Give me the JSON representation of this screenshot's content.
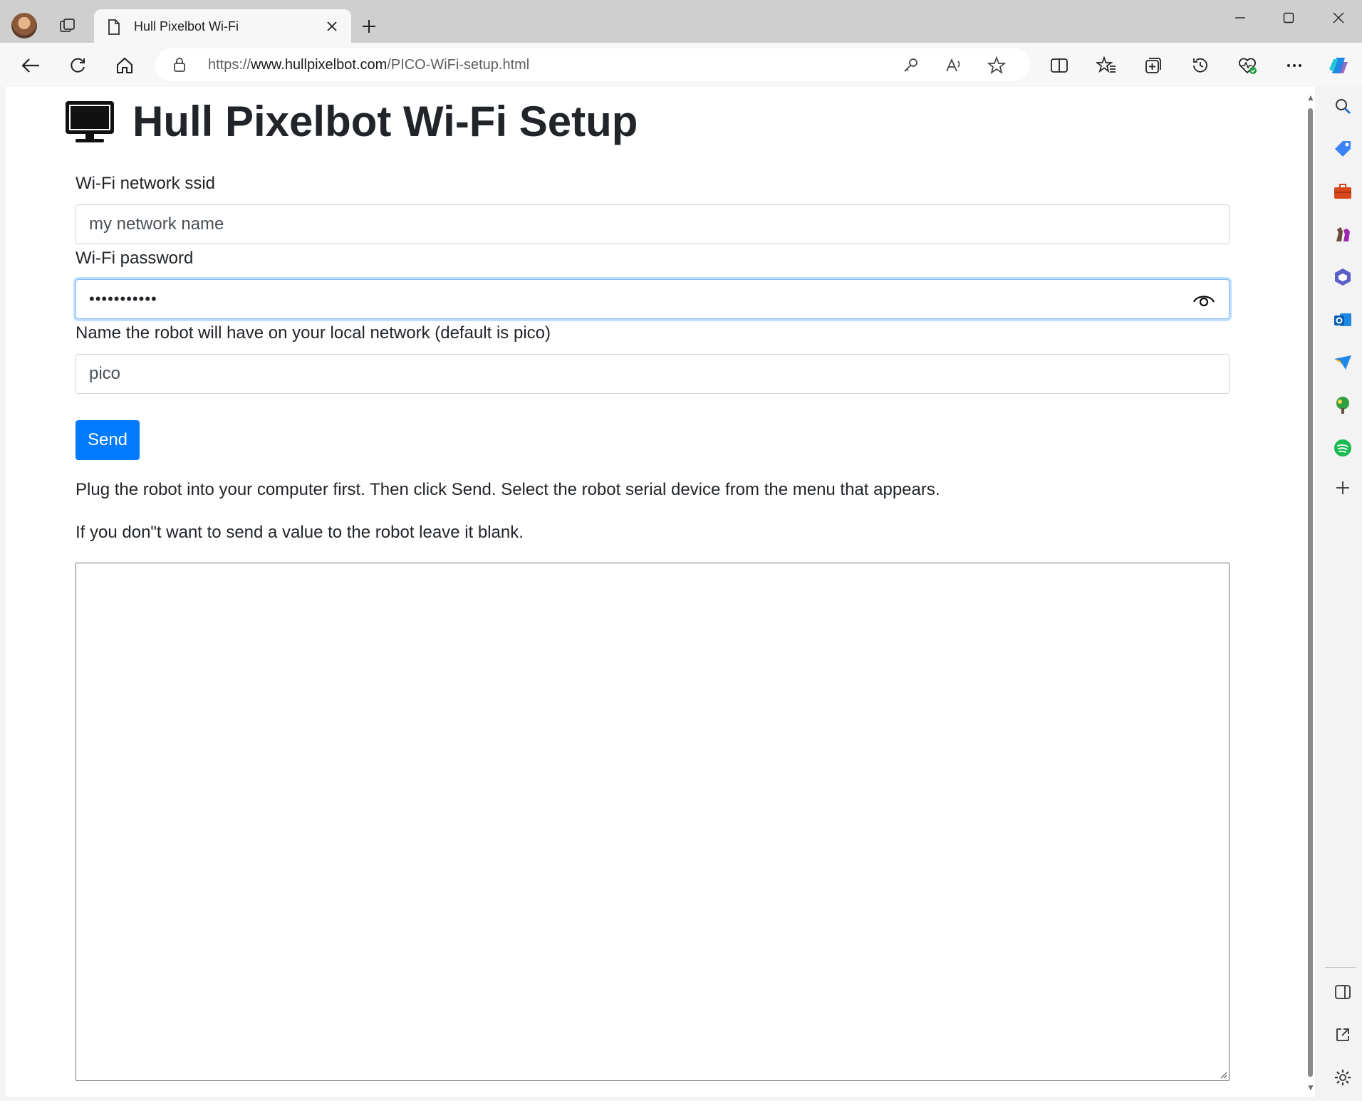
{
  "browser": {
    "tab_title": "Hull Pixelbot Wi-Fi",
    "url_prefix": "https://",
    "url_host": "www.hullpixelbot.com",
    "url_path": "/PICO-WiFi-setup.html"
  },
  "page": {
    "title": "Hull Pixelbot Wi-Fi Setup",
    "ssid_label": "Wi-Fi network ssid",
    "ssid_value": "my network name",
    "password_label": "Wi-Fi password",
    "password_masked": "•••••••••••",
    "hostname_label": "Name the robot will have on your local network (default is pico)",
    "hostname_value": "pico",
    "send_label": "Send",
    "instructions": "Plug the robot into your computer first. Then click Send. Select the robot serial device from the menu that appears.",
    "blank_note": "If you don\"t want to send a value to the robot leave it blank.",
    "output_text": ""
  },
  "colors": {
    "primary": "#007bff",
    "focus_border": "#80bdff",
    "text": "#212529"
  },
  "icons": {
    "toolbar": [
      "back-icon",
      "refresh-icon",
      "home-icon",
      "lock-icon",
      "key-icon",
      "read-aloud-icon",
      "favorite-star-icon",
      "split-screen-icon",
      "favorites-icon",
      "collections-icon",
      "history-icon",
      "browser-essentials-icon",
      "more-icon",
      "copilot-icon"
    ],
    "sidebar": [
      "search-icon",
      "shopping-icon",
      "tools-icon",
      "games-icon",
      "microsoft-365-icon",
      "outlook-icon",
      "drop-icon",
      "tree-icon",
      "spotify-icon",
      "add-icon",
      "sidebar-toggle-icon",
      "external-link-icon",
      "settings-icon"
    ]
  }
}
